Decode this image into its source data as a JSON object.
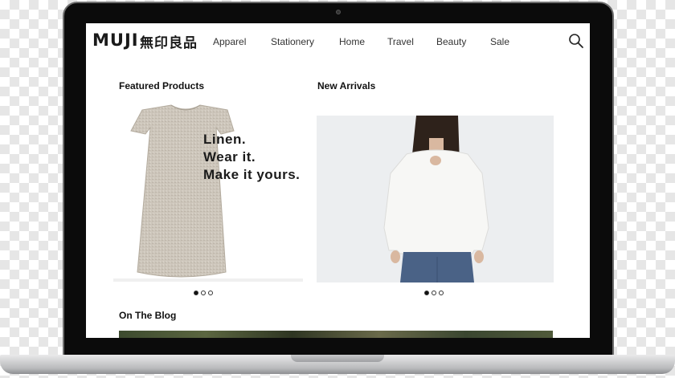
{
  "brand": {
    "name_en": "MUJI",
    "name_jp": "無印良品"
  },
  "nav": {
    "items": [
      {
        "label": "Apparel"
      },
      {
        "label": "Stationery"
      },
      {
        "label": "Home"
      },
      {
        "label": "Travel"
      },
      {
        "label": "Beauty"
      },
      {
        "label": "Sale"
      }
    ],
    "search_icon": "search-icon"
  },
  "featured": {
    "title": "Featured Products",
    "promo_lines": [
      "Linen.",
      "Wear it.",
      "Make it yours."
    ],
    "carousel": {
      "count": 3,
      "active": 0
    }
  },
  "new_arrivals": {
    "title": "New Arrivals",
    "carousel": {
      "count": 3,
      "active": 0
    }
  },
  "blog": {
    "title": "On The Blog"
  },
  "colors": {
    "text": "#111111",
    "screen_bg": "#ffffff",
    "bezel": "#0b0b0b"
  }
}
